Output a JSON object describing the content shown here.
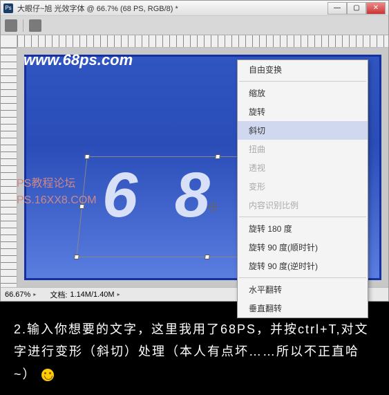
{
  "window": {
    "title": "大眼仔~旭 光效字体 @ 66.7% (68 PS, RGB/8) *",
    "ps_icon": "Ps"
  },
  "watermarks": {
    "url": "www.68ps.com",
    "forum_line1": "PS教程论坛",
    "forum_line2": "PS.16XX8.COM"
  },
  "canvas": {
    "text": "6 8 P"
  },
  "context_menu": {
    "items": [
      {
        "label": "自由变换",
        "enabled": true
      },
      {
        "sep": true
      },
      {
        "label": "缩放",
        "enabled": true
      },
      {
        "label": "旋转",
        "enabled": true
      },
      {
        "label": "斜切",
        "enabled": true,
        "selected": true
      },
      {
        "label": "扭曲",
        "enabled": false
      },
      {
        "label": "透视",
        "enabled": false
      },
      {
        "label": "变形",
        "enabled": false
      },
      {
        "label": "内容识别比例",
        "enabled": false
      },
      {
        "sep": true
      },
      {
        "label": "旋转 180 度",
        "enabled": true
      },
      {
        "label": "旋转 90 度(顺时针)",
        "enabled": true
      },
      {
        "label": "旋转 90 度(逆时针)",
        "enabled": true
      },
      {
        "sep": true
      },
      {
        "label": "水平翻转",
        "enabled": true
      },
      {
        "label": "垂直翻转",
        "enabled": true
      }
    ]
  },
  "statusbar": {
    "zoom": "66.67%",
    "doc_label": "文档:",
    "doc_value": "1.14M/1.40M"
  },
  "caption": {
    "text": "2.输入你想要的文字，这里我用了68PS，并按ctrl+T,对文字进行变形（斜切）处理（本人有点坏……所以不正直哈~）"
  }
}
